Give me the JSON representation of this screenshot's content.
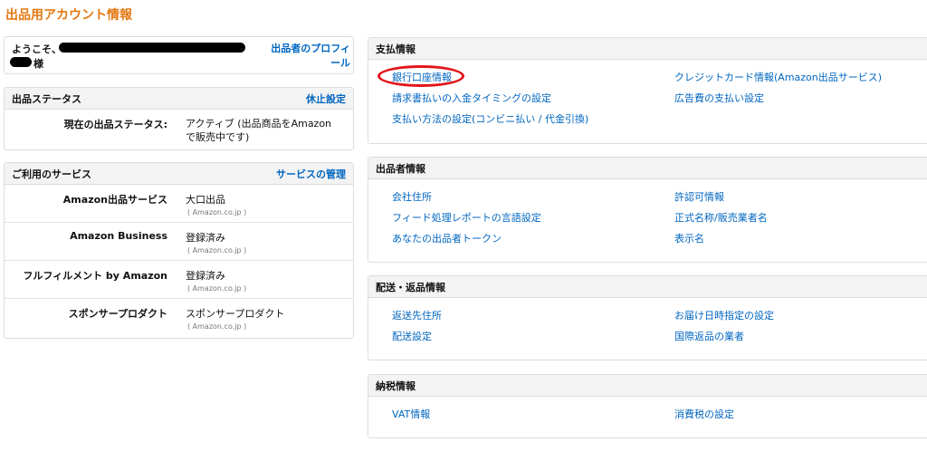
{
  "page": {
    "title": "出品用アカウント情報"
  },
  "welcome": {
    "greeting": "ようこそ、",
    "honorific": "様",
    "profile_link": "出品者のプロフィール"
  },
  "status": {
    "title": "出品ステータス",
    "action": "休止設定",
    "label": "現在の出品ステータス:",
    "value": "アクティブ (出品商品をAmazonで販売中です)"
  },
  "services": {
    "title": "ご利用のサービス",
    "action": "サービスの管理",
    "rows": [
      {
        "name": "Amazon出品サービス",
        "value": "大口出品",
        "sub": "( Amazon.co.jp )"
      },
      {
        "name": "Amazon Business",
        "value": "登録済み",
        "sub": "( Amazon.co.jp )"
      },
      {
        "name": "フルフィルメント by Amazon",
        "value": "登録済み",
        "sub": "( Amazon.co.jp )"
      },
      {
        "name": "スポンサープロダクト",
        "value": "スポンサープロダクト",
        "sub": "( Amazon.co.jp )"
      }
    ]
  },
  "payment": {
    "title": "支払情報",
    "left": [
      "銀行口座情報",
      "請求書払いの入金タイミングの設定",
      "支払い方法の設定(コンビニ払い / 代金引換)"
    ],
    "right": [
      "クレジットカード情報(Amazon出品サービス)",
      "広告費の支払い設定"
    ]
  },
  "seller": {
    "title": "出品者情報",
    "left": [
      "会社住所",
      "フィード処理レポートの言語設定",
      "あなたの出品者トークン"
    ],
    "right": [
      "許認可情報",
      "正式名称/販売業者名",
      "表示名"
    ]
  },
  "shipping": {
    "title": "配送・返品情報",
    "left": [
      "返送先住所",
      "配送設定"
    ],
    "right": [
      "お届け日時指定の設定",
      "国際返品の業者"
    ]
  },
  "tax": {
    "title": "納税情報",
    "left": [
      "VAT情報"
    ],
    "right": [
      "消費税の設定"
    ]
  },
  "colors": {
    "title": "#e47911",
    "link": "#0066c0",
    "highlight": "#e3141a"
  }
}
